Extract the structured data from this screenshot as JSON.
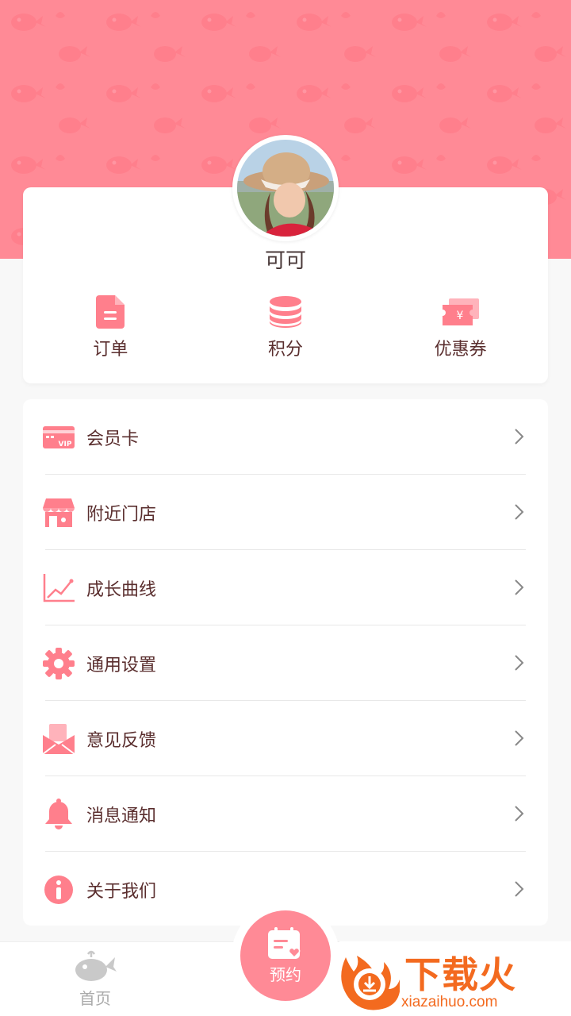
{
  "profile": {
    "name": "可可"
  },
  "quick_links": [
    {
      "label": "订单",
      "icon": "order-icon"
    },
    {
      "label": "积分",
      "icon": "coins-icon"
    },
    {
      "label": "优惠券",
      "icon": "coupon-icon"
    }
  ],
  "menu": [
    {
      "label": "会员卡",
      "icon": "vip-card-icon"
    },
    {
      "label": "附近门店",
      "icon": "store-icon"
    },
    {
      "label": "成长曲线",
      "icon": "growth-chart-icon"
    },
    {
      "label": "通用设置",
      "icon": "gear-icon"
    },
    {
      "label": "意见反馈",
      "icon": "feedback-envelope-icon"
    },
    {
      "label": "消息通知",
      "icon": "bell-icon"
    },
    {
      "label": "关于我们",
      "icon": "info-icon"
    }
  ],
  "tabbar": {
    "home_label": "首页",
    "book_label": "预约"
  },
  "watermark": {
    "title": "下载火",
    "subtitle": "xiazaihuo.com"
  },
  "colors": {
    "accent": "#ff8a96",
    "text": "#5a2e2e",
    "background": "#f8f8f8",
    "watermark": "#f36a1f"
  }
}
